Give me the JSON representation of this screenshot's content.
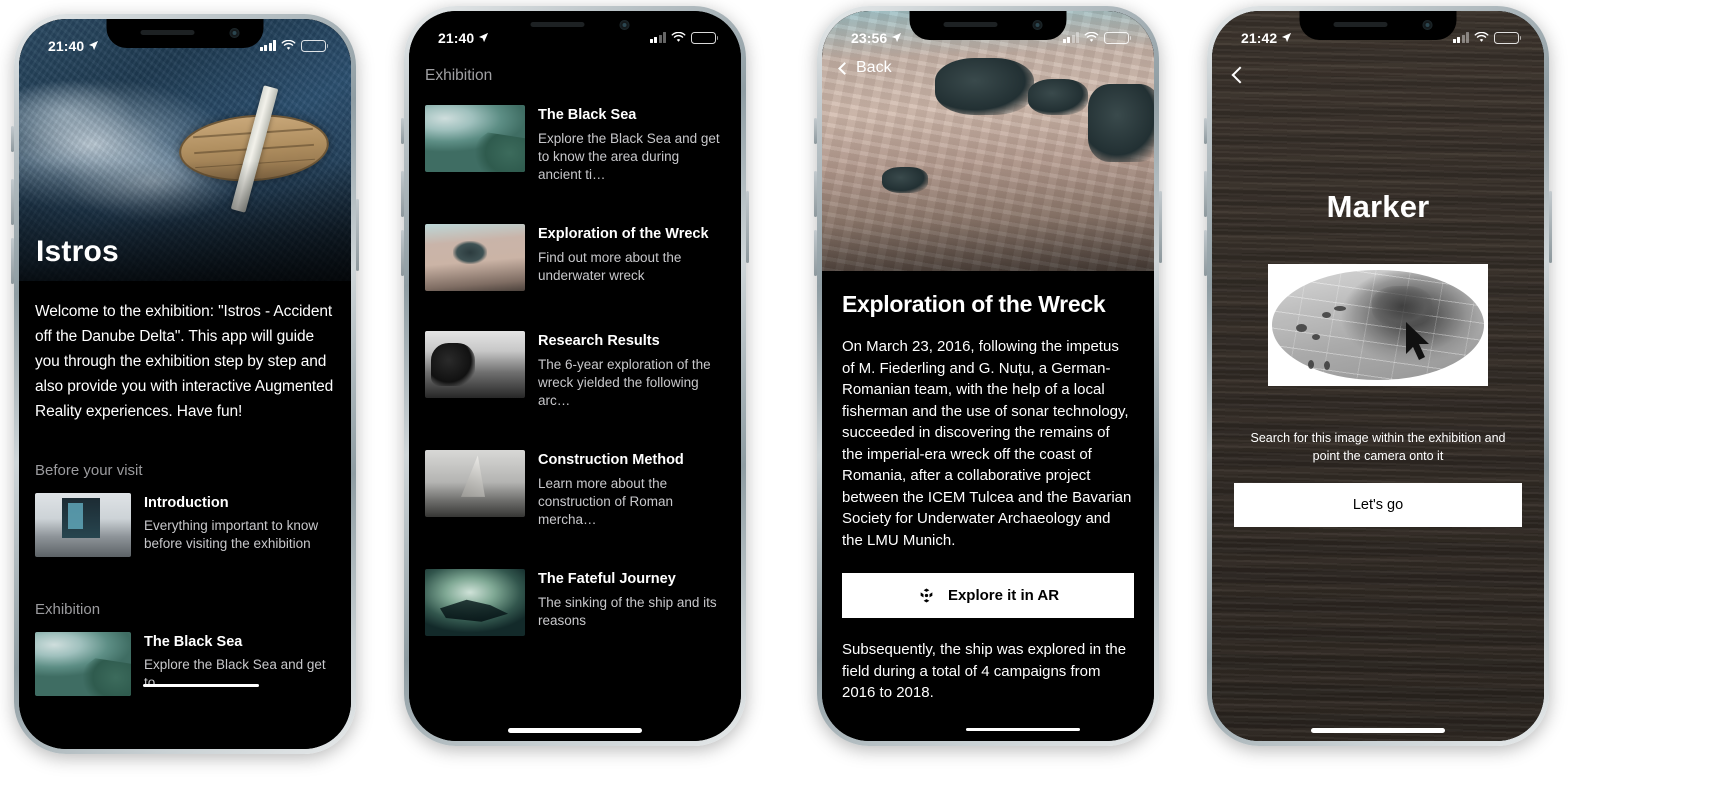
{
  "phones": [
    {
      "id": "phone1",
      "status": {
        "time": "21:40",
        "location_icon": "location-arrow-icon",
        "signal_icon": "cellular-signal-icon",
        "wifi_icon": "wifi-icon",
        "battery_icon": "battery-icon"
      },
      "hero_title": "Istros",
      "intro": "Welcome to the exhibition: \"Istros - Accident off the Danube Delta\". This app will guide you through the exhibition step by step and also provide you with interactive Augmented Reality experiences. Have fun!",
      "section_before": "Before your visit",
      "section_exhibition": "Exhibition",
      "cards": [
        {
          "title": "Introduction",
          "subtitle": "Everything important to know before visiting the exhibition",
          "thumb": "museum-thumb"
        },
        {
          "title": "The Black Sea",
          "subtitle": "Explore the Black Sea and get to",
          "thumb": "black-sea-thumb"
        }
      ]
    },
    {
      "id": "phone2",
      "status": {
        "time": "21:40"
      },
      "header": "Exhibition",
      "items": [
        {
          "title": "The Black Sea",
          "subtitle": "Explore the Black Sea and get to know the area during ancient ti…",
          "thumb": "black-sea-thumb"
        },
        {
          "title": "Exploration of the Wreck",
          "subtitle": "Find out more about the underwater wreck",
          "thumb": "wreck-thumb"
        },
        {
          "title": "Research Results",
          "subtitle": "The 6-year exploration of the wreck yielded the following arc…",
          "thumb": "research-thumb"
        },
        {
          "title": "Construction Method",
          "subtitle": "Learn more about the construction of Roman mercha…",
          "thumb": "construction-thumb"
        },
        {
          "title": "The Fateful Journey",
          "subtitle": "The sinking of the ship and its reasons",
          "thumb": "fateful-thumb"
        }
      ]
    },
    {
      "id": "phone3",
      "status": {
        "time": "23:56"
      },
      "back_label": "Back",
      "title": "Exploration of the Wreck",
      "paragraph1": "On March 23, 2016, following the impetus of M. Fiederling and G. Nuțu, a German-Romanian team, with the help of a local fisherman and the use of sonar technology, succeeded in discovering the remains of the imperial-era wreck off the coast of Romania, after a collaborative project between the ICEM Tulcea and the Bavarian Society for Underwater Archaeology and the LMU Munich.",
      "ar_button_label": "Explore it in AR",
      "ar_button_icon": "ar-cube-icon",
      "paragraph2": "Subsequently, the ship was explored in the field during a total of 4 campaigns from 2016 to 2018."
    },
    {
      "id": "phone4",
      "status": {
        "time": "21:42"
      },
      "back_icon": "chevron-left-icon",
      "title": "Marker",
      "caption": "Search for this image within the exhibition and point the camera onto it",
      "button_label": "Let's go",
      "marker_image": "wreck-site-plan-image"
    }
  ],
  "colors": {
    "background": "#ffffff",
    "screen_black": "#000000",
    "accent_white": "#ffffff",
    "muted_text": "#9b9b9e",
    "sub_text": "#c8c8cb",
    "wood": "#342d27"
  }
}
